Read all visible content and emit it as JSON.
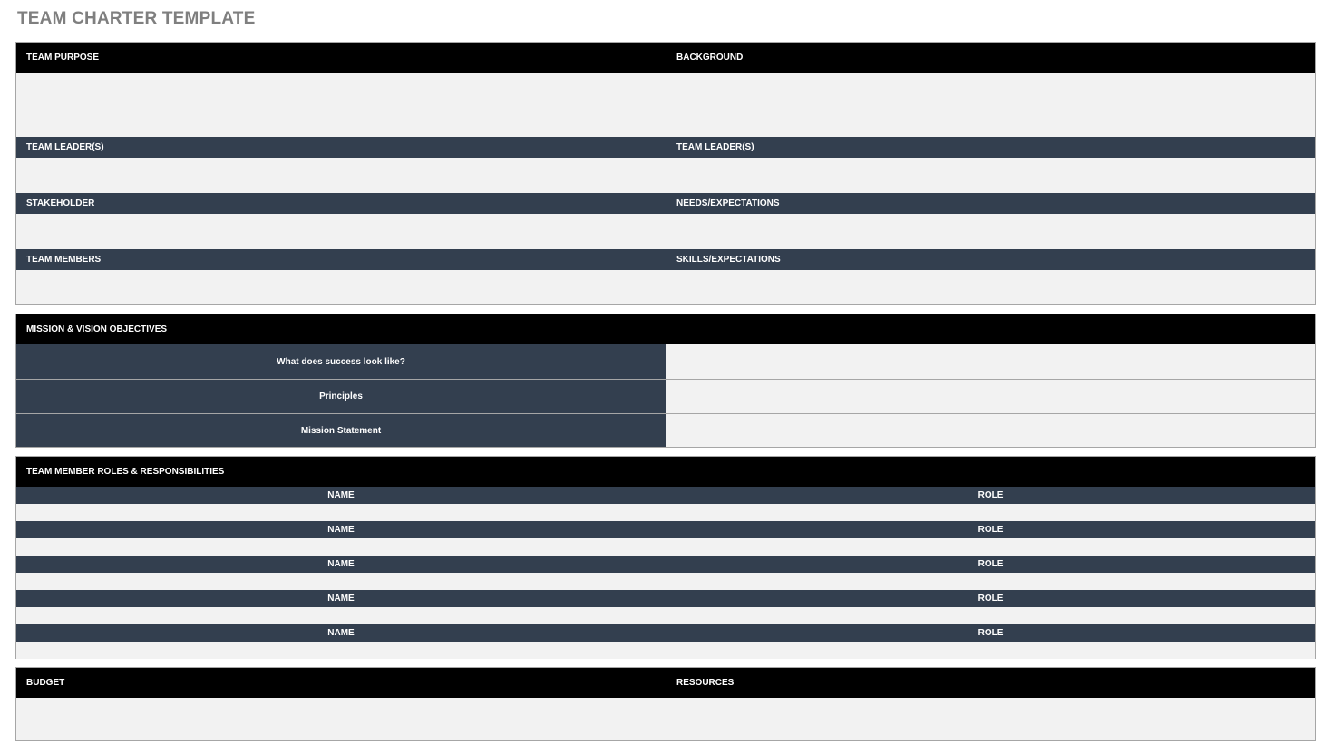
{
  "title": "TEAM CHARTER TEMPLATE",
  "section1": {
    "header_left": "TEAM PURPOSE",
    "header_right": "BACKGROUND",
    "sub_rows": [
      {
        "left": "TEAM LEADER(S)",
        "right": "TEAM LEADER(S)"
      },
      {
        "left": "STAKEHOLDER",
        "right": "NEEDS/EXPECTATIONS"
      },
      {
        "left": "TEAM MEMBERS",
        "right": "SKILLS/EXPECTATIONS"
      }
    ]
  },
  "section2": {
    "header": "MISSION & VISION OBJECTIVES",
    "rows": [
      "What does success look like?",
      "Principles",
      "Mission Statement"
    ]
  },
  "section3": {
    "header": "TEAM MEMBER ROLES & RESPONSIBILITIES",
    "rows": [
      {
        "left": "NAME",
        "right": "ROLE"
      },
      {
        "left": "NAME",
        "right": "ROLE"
      },
      {
        "left": "NAME",
        "right": "ROLE"
      },
      {
        "left": "NAME",
        "right": "ROLE"
      },
      {
        "left": "NAME",
        "right": "ROLE"
      }
    ]
  },
  "section4": {
    "header_left": "BUDGET",
    "header_right": "RESOURCES"
  },
  "colors": {
    "black_header": "#000000",
    "navy_header": "#333f4f",
    "body_fill": "#f2f2f2",
    "border": "#a6a6a6",
    "title": "#7f7f7f"
  }
}
